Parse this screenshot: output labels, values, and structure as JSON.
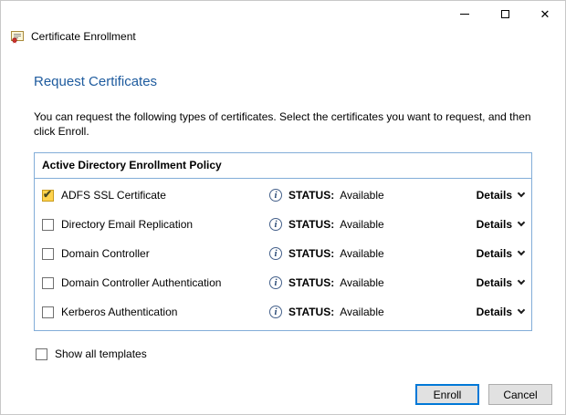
{
  "window": {
    "app_title": "Certificate Enrollment",
    "close_glyph": "✕"
  },
  "page": {
    "title": "Request Certificates",
    "description": "You can request the following types of certificates. Select the certificates you want to request, and then click Enroll."
  },
  "policy": {
    "header": "Active Directory Enrollment Policy",
    "rows": [
      {
        "label": "ADFS SSL Certificate",
        "checked": true,
        "status_label": "STATUS:",
        "status_value": "Available",
        "details_label": "Details"
      },
      {
        "label": "Directory Email Replication",
        "checked": false,
        "status_label": "STATUS:",
        "status_value": "Available",
        "details_label": "Details"
      },
      {
        "label": "Domain Controller",
        "checked": false,
        "status_label": "STATUS:",
        "status_value": "Available",
        "details_label": "Details"
      },
      {
        "label": "Domain Controller Authentication",
        "checked": false,
        "status_label": "STATUS:",
        "status_value": "Available",
        "details_label": "Details"
      },
      {
        "label": "Kerberos Authentication",
        "checked": false,
        "status_label": "STATUS:",
        "status_value": "Available",
        "details_label": "Details"
      }
    ]
  },
  "show_all": {
    "label": "Show all templates",
    "checked": false
  },
  "footer": {
    "enroll_label": "Enroll",
    "cancel_label": "Cancel"
  },
  "icons": {
    "info_letter": "i",
    "check_glyph": "✔",
    "certificate_icon": "certificate",
    "minimize_icon": "minimize",
    "maximize_icon": "maximize",
    "close_icon": "close"
  },
  "colors": {
    "heading_blue": "#1e5b9e",
    "box_border_blue": "#82add8",
    "focus_button_blue": "#0078d7",
    "checked_checkbox_fill": "#ffd34d",
    "button_gray": "#e1e1e1"
  }
}
